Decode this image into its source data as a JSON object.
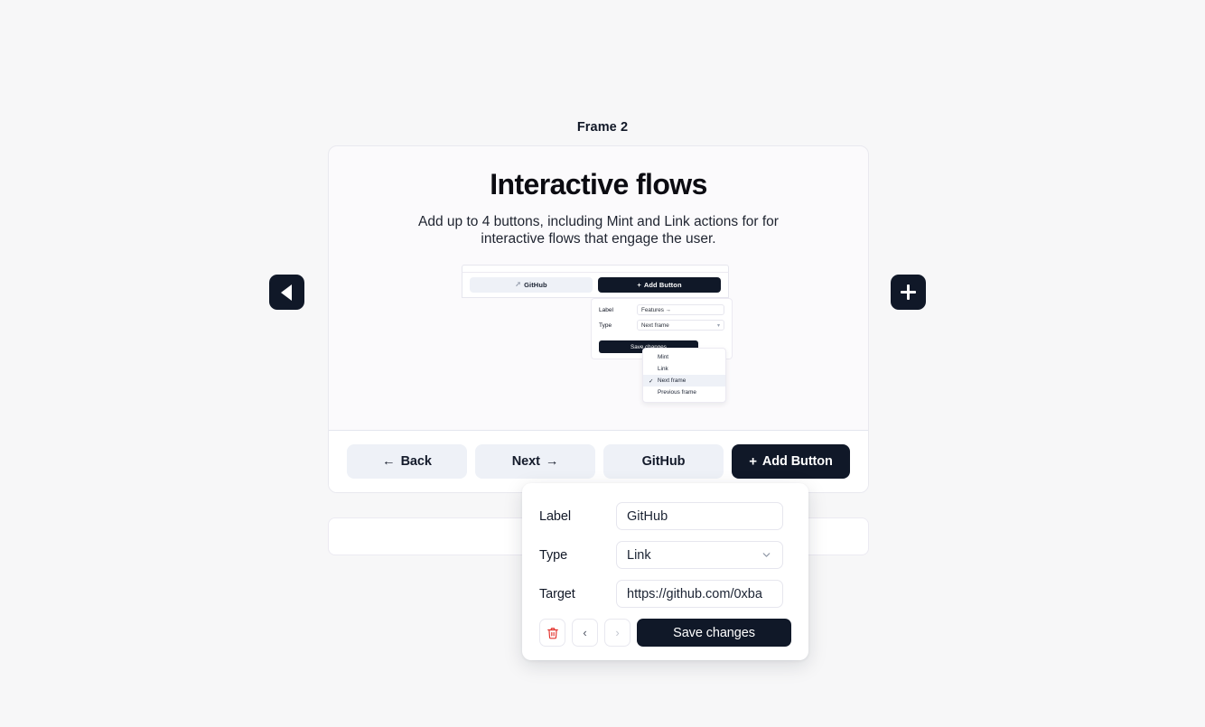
{
  "frame": {
    "title": "Frame 2"
  },
  "hero": {
    "title": "Interactive flows",
    "subtitle": "Add up to 4 buttons, including Mint and Link actions for for interactive flows that engage the user."
  },
  "preview": {
    "github_button": {
      "label": "GitHub",
      "icon": "cursor-icon"
    },
    "add_button": {
      "label": "Add Button",
      "icon": "plus-icon"
    },
    "form": {
      "label_field": {
        "label": "Label",
        "value": "Features →"
      },
      "type_field": {
        "label": "Type",
        "value": "Next frame",
        "icon": "chevron-down-icon"
      },
      "save_label": "Save changes"
    },
    "dropdown": {
      "options": [
        {
          "label": "Mint",
          "selected": false
        },
        {
          "label": "Link",
          "selected": false
        },
        {
          "label": "Next frame",
          "selected": true
        },
        {
          "label": "Previous frame",
          "selected": false
        }
      ],
      "check_glyph": "✓"
    }
  },
  "footer_buttons": [
    {
      "label": "Back",
      "icon": "arrow-left",
      "glyph": "←",
      "style": "ghost",
      "icon_position": "before"
    },
    {
      "label": "Next",
      "icon": "arrow-right",
      "glyph": "→",
      "style": "ghost",
      "icon_position": "after"
    },
    {
      "label": "GitHub",
      "icon": "",
      "glyph": "",
      "style": "ghost",
      "icon_position": "none"
    },
    {
      "label": "Add Button",
      "icon": "plus-icon",
      "glyph": "+",
      "style": "dark",
      "icon_position": "before"
    }
  ],
  "nav": {
    "prev_frame": {
      "icon": "triangle-left-icon",
      "label": ""
    },
    "add_frame": {
      "icon": "plus-icon",
      "label": ""
    }
  },
  "editor": {
    "label_row": {
      "label": "Label",
      "value": "GitHub"
    },
    "type_row": {
      "label": "Type",
      "value": "Link",
      "icon": "chevron-down-icon",
      "options": [
        "Mint",
        "Link",
        "Next frame",
        "Previous frame"
      ]
    },
    "target_row": {
      "label": "Target",
      "value": "https://github.com/0xba"
    },
    "actions": {
      "delete": {
        "glyph": "🗑",
        "icon": "trash-icon"
      },
      "previous": {
        "glyph": "‹",
        "icon": "chevron-left-icon"
      },
      "next": {
        "glyph": "›",
        "icon": "chevron-right-icon"
      },
      "save_label": "Save changes"
    }
  },
  "colors": {
    "page_bg": "#f7f7f8",
    "card_bg": "#fbfafc",
    "dark": "#101828",
    "ghost": "#eef1f7",
    "danger": "#e3342f",
    "border": "#e6e6ee"
  }
}
